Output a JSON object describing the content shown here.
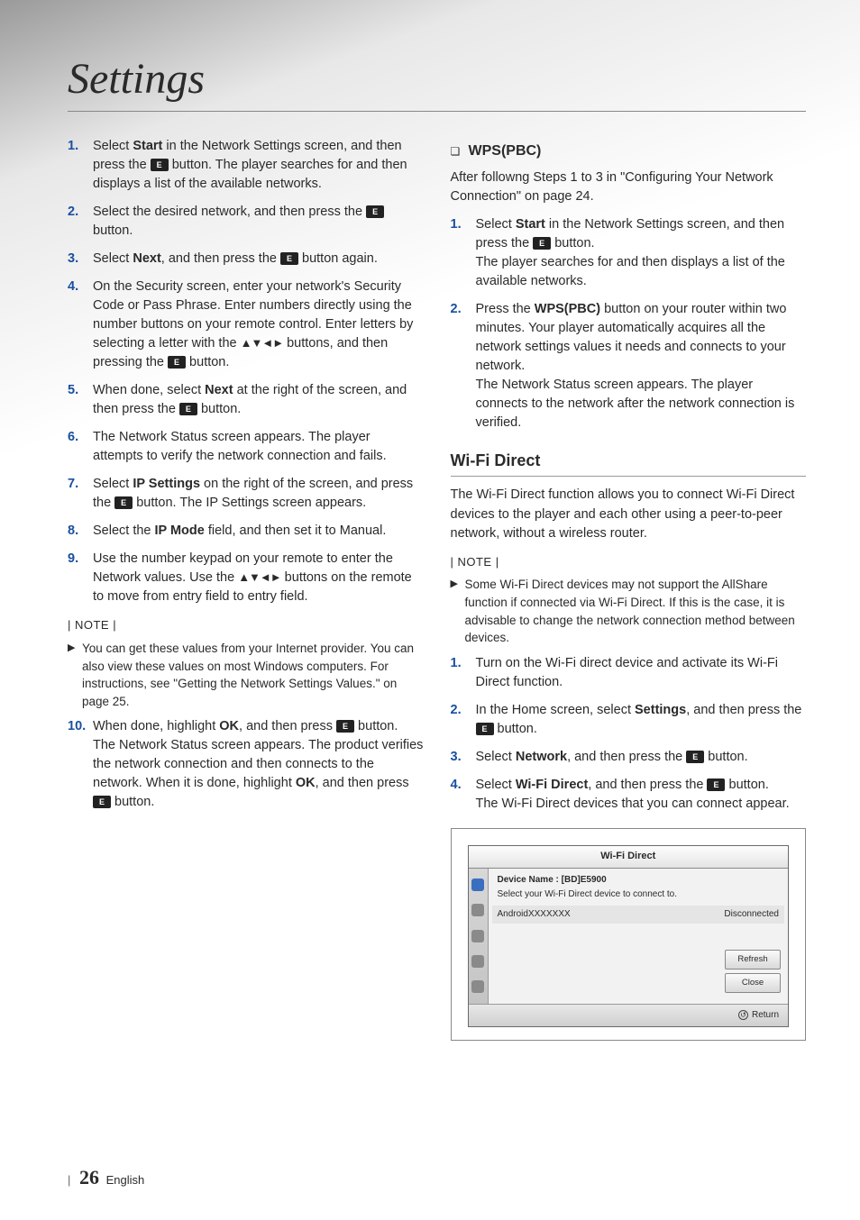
{
  "title": "Settings",
  "icons": {
    "enter": "E",
    "arrows": "▲▼◄►",
    "note_arrow": "▶",
    "sub_bullet": "❏",
    "return": "↺"
  },
  "left": {
    "steps_a": [
      {
        "n": "1.",
        "pre": "Select ",
        "b": "Start",
        "post": " in the Network Settings screen, and then press the ",
        "after": " button. The player searches for and then displays a list of the available networks."
      },
      {
        "n": "2.",
        "pre": "Select the desired network, and then press the ",
        "b": "",
        "post": "",
        "after": " button."
      },
      {
        "n": "3.",
        "pre": "Select ",
        "b": "Next",
        "post": ", and then press the ",
        "after": " button again."
      },
      {
        "n": "4.",
        "pre": "On the Security screen, enter your network's Security Code or Pass Phrase. Enter numbers directly using the number buttons on your remote control. Enter letters by selecting a letter with the ",
        "b": "",
        "post": "",
        "arrows": true,
        "mid": " buttons, and then pressing the ",
        "after": " button."
      },
      {
        "n": "5.",
        "pre": "When done, select ",
        "b": "Next",
        "post": " at the right of the screen, and then press the ",
        "after": " button."
      },
      {
        "n": "6.",
        "plain": "The Network Status screen appears. The player attempts to verify the network connection and fails."
      },
      {
        "n": "7.",
        "pre": "Select ",
        "b": "IP Settings",
        "post": " on the right of the screen, and press the ",
        "after": " button. The IP Settings screen appears."
      },
      {
        "n": "8.",
        "pre": "Select the ",
        "b": "IP Mode",
        "post": " field, and then set it to Manual."
      },
      {
        "n": "9.",
        "pre": "Use the number keypad on your remote to enter the Network values. Use the ",
        "arrows": true,
        "mid": " buttons on the remote to move from entry field to entry field."
      }
    ],
    "note_hdr": "| NOTE |",
    "note": "You can get these values from your Internet provider. You can also view these values on most Windows computers. For instructions, see \"Getting the Network Settings Values.\" on page 25.",
    "steps_b": [
      {
        "n": "10.",
        "pre": "When done, highlight ",
        "b": "OK",
        "post": ", and then press ",
        "after": " button. The Network Status screen appears. The product verifies the network connection and then connects to the network. When it is done, highlight ",
        "b2": "OK",
        "post2": ", and then press ",
        "after2": " button."
      }
    ]
  },
  "right": {
    "wps_hdr": "WPS(PBC)",
    "wps_intro": "After followng Steps 1 to 3 in \"Configuring Your Network Connection\" on page 24.",
    "wps_steps": [
      {
        "n": "1.",
        "pre": "Select ",
        "b": "Start",
        "post": " in the Network Settings screen, and then press the ",
        "after": " button.",
        "tail": "The player searches for and then displays a list of the available networks."
      },
      {
        "n": "2.",
        "pre": "Press the ",
        "b": "WPS(PBC)",
        "post": " button on your router within two minutes. Your player automatically acquires all the network settings values it needs and connects to your network.",
        "tail": "The Network Status screen appears. The player connects to the network after the network connection is verified."
      }
    ],
    "wifi_hdr": "Wi-Fi Direct",
    "wifi_intro": "The Wi-Fi Direct function allows you to connect Wi-Fi Direct devices to the player and each other using a peer-to-peer network, without a wireless router.",
    "note_hdr": "| NOTE |",
    "note": "Some Wi-Fi Direct devices may not support the AllShare function if connected via Wi-Fi Direct. If this is the case, it is advisable to change the network connection method between devices.",
    "wifi_steps": [
      {
        "n": "1.",
        "plain": "Turn on the Wi-Fi direct device and activate its Wi-Fi Direct function."
      },
      {
        "n": "2.",
        "pre": "In the Home screen, select ",
        "b": "Settings",
        "post": ", and then press the ",
        "after": " button."
      },
      {
        "n": "3.",
        "pre": "Select ",
        "b": "Network",
        "post": ", and then press the ",
        "after": " button."
      },
      {
        "n": "4.",
        "pre": "Select ",
        "b": "Wi-Fi Direct",
        "post": ", and then press the ",
        "after": " button.",
        "tail": "The Wi-Fi Direct devices that you can connect appear."
      }
    ]
  },
  "shot": {
    "title": "Wi-Fi Direct",
    "device_name": "Device Name : [BD]E5900",
    "select": "Select your Wi-Fi Direct device to connect to.",
    "row_name": "AndroidXXXXXXX",
    "row_status": "Disconnected",
    "btn_refresh": "Refresh",
    "btn_close": "Close",
    "return": "Return"
  },
  "footer": {
    "page": "26",
    "lang": "English"
  }
}
